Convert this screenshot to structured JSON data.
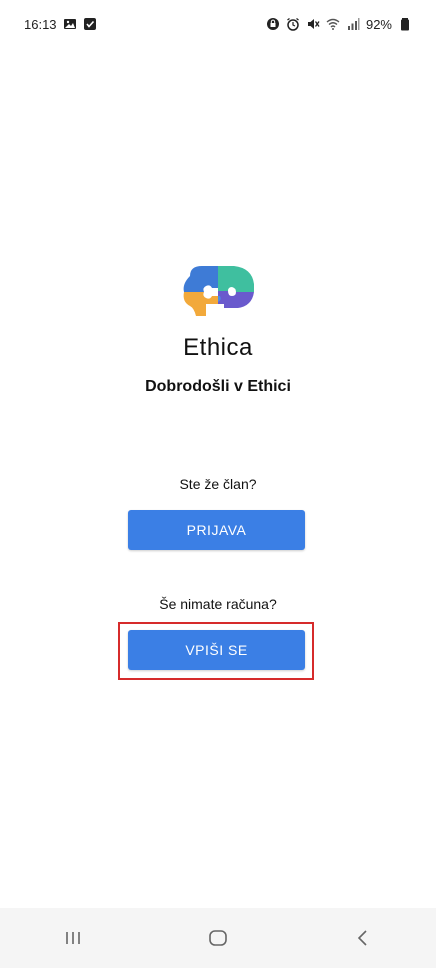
{
  "status_bar": {
    "time": "16:13",
    "battery": "92%",
    "left_icons": [
      "image-icon",
      "check-box-icon"
    ],
    "right_icons": [
      "vpn-icon",
      "alarm-icon",
      "mute-icon",
      "wifi-icon",
      "signal-icon",
      "battery-icon"
    ]
  },
  "app": {
    "name": "Ethica",
    "welcome": "Dobrodošli v Ethici",
    "logo_icon": "brain-puzzle-icon"
  },
  "login": {
    "prompt": "Ste že član?",
    "button_label": "PRIJAVA"
  },
  "signup": {
    "prompt": "Še nimate računa?",
    "button_label": "VPIŠI SE"
  },
  "navigation": {
    "items": [
      "recent-apps-icon",
      "home-icon",
      "back-icon"
    ]
  },
  "colors": {
    "primary_button": "#3b7fe5",
    "highlight_border": "#d62b2b",
    "logo_blue": "#3e7bd6",
    "logo_teal": "#3fbf9f",
    "logo_orange": "#f2a93b",
    "logo_purple": "#6a5acd"
  }
}
